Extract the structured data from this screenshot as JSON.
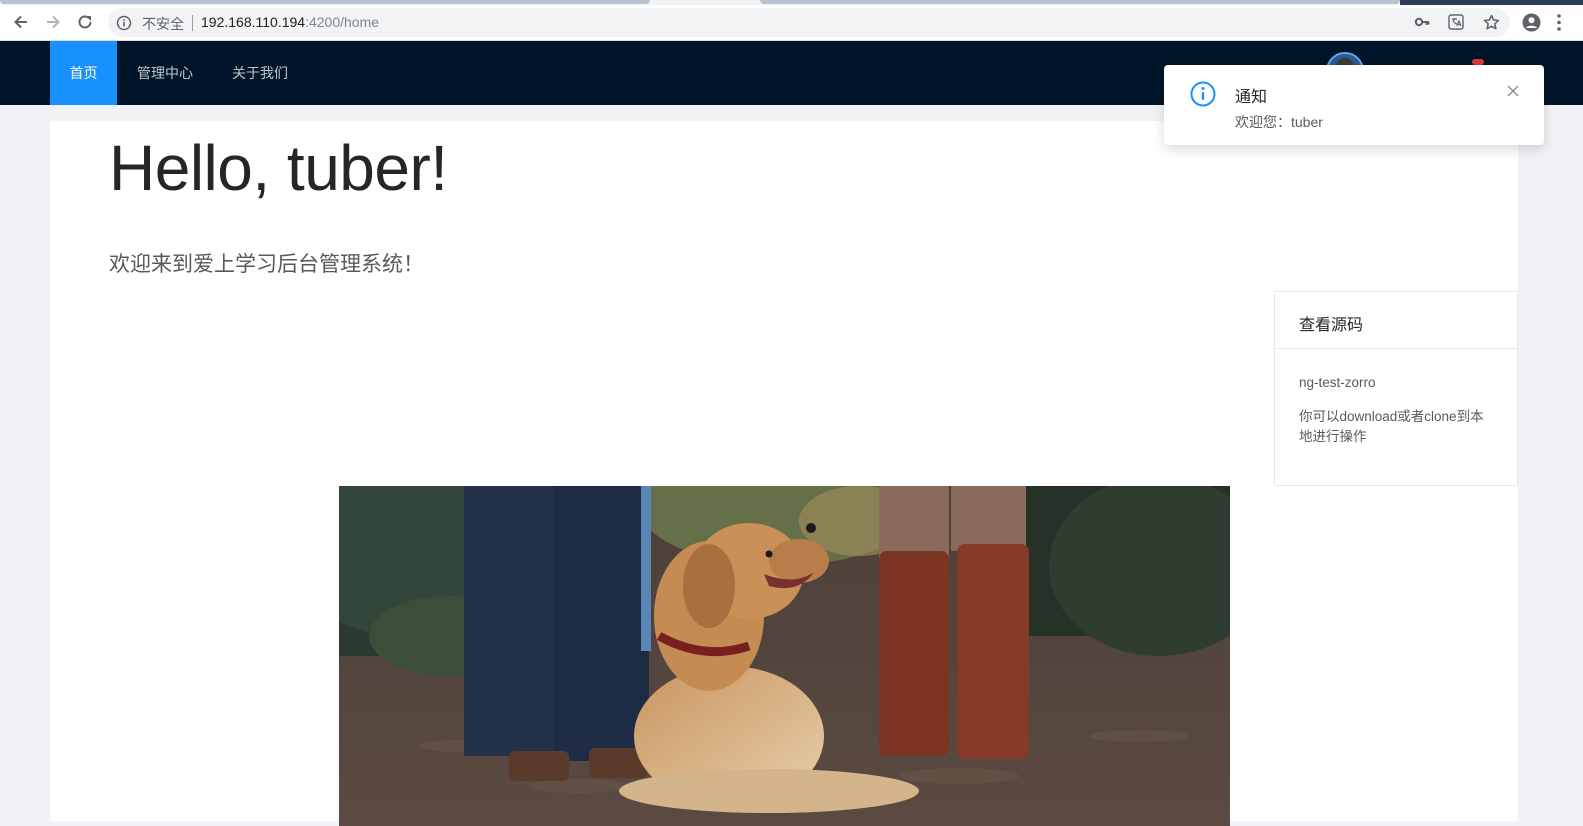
{
  "browser": {
    "security_label": "不安全",
    "url_host": "192.168.110.194",
    "url_rest": ":4200/home",
    "icons": [
      "back-icon",
      "forward-icon",
      "reload-icon",
      "info-icon",
      "key-icon",
      "translate-icon",
      "star-icon",
      "account-icon",
      "more-icon"
    ]
  },
  "header": {
    "menu": [
      {
        "label": "首页",
        "active": true
      },
      {
        "label": "管理中心",
        "active": false
      },
      {
        "label": "关于我们",
        "active": false
      }
    ],
    "colors": {
      "background": "#001529",
      "active": "#1890ff"
    }
  },
  "main": {
    "greeting": "Hello, tuber!",
    "welcome": "欢迎来到爱上学习后台管理系统！"
  },
  "side_card": {
    "title": "查看源码",
    "repo": "ng-test-zorro",
    "description": "你可以download或者clone到本地进行操作"
  },
  "notification": {
    "title": "通知",
    "message": "欢迎您：tuber",
    "icon": "info-circle-icon",
    "icon_color": "#1890ff"
  }
}
